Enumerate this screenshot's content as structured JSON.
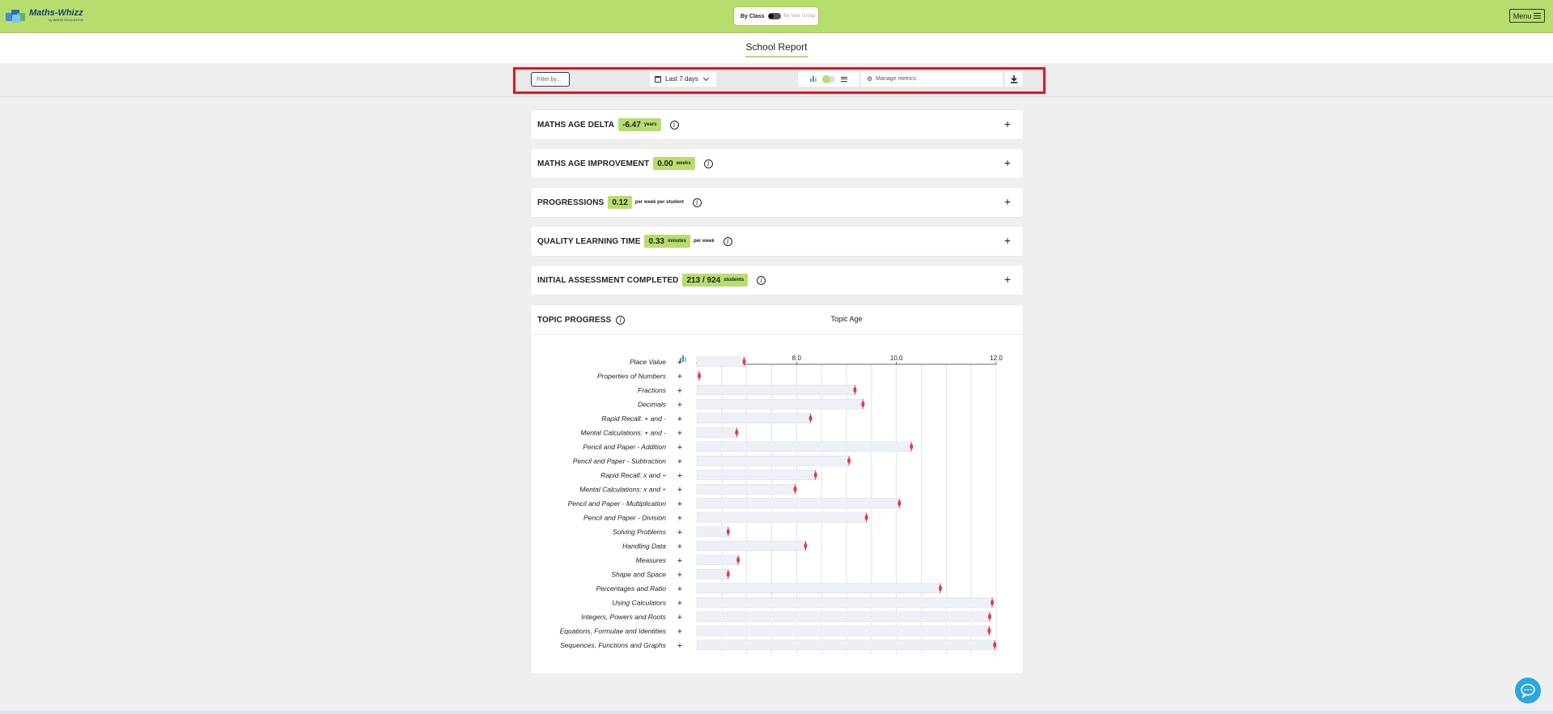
{
  "header": {
    "logo_text": "Maths-Whizz",
    "logo_subtext": "by WHIZZ EDUCATION",
    "toggle_left_label": "By Class",
    "toggle_right_label": "By Year Group",
    "menu_label": "Menu"
  },
  "page": {
    "title": "School Report"
  },
  "toolbar": {
    "filter_label": "Filter by...",
    "date_range_label": "Last 7 days",
    "manage_metrics_label": "Manage metrics"
  },
  "metrics": [
    {
      "title": "MATHS AGE DELTA",
      "value": "-6.47",
      "unit": "years",
      "extra": ""
    },
    {
      "title": "MATHS AGE IMPROVEMENT",
      "value": "0.00",
      "unit": "weeks",
      "extra": ""
    },
    {
      "title": "PROGRESSIONS",
      "value": "0.12",
      "unit": "",
      "extra": "per week per student"
    },
    {
      "title": "QUALITY LEARNING TIME",
      "value": "0.33",
      "unit": "minutes",
      "extra": "per week"
    },
    {
      "title": "INITIAL ASSESSMENT COMPLETED",
      "value": "213 / 924",
      "unit": "students",
      "extra": ""
    }
  ],
  "topic_progress": {
    "title": "TOPIC PROGRESS"
  },
  "colors": {
    "brand_green": "#b7dd6e",
    "highlight_red": "#e5141b",
    "marker_red": "#e53a4a",
    "chat_blue": "#2ca7de"
  },
  "chart_data": {
    "type": "bar",
    "title": "",
    "xlabel": "Topic Age",
    "ylabel": "",
    "xlim": [
      6,
      12
    ],
    "xticks": [
      8.0,
      10.0,
      12.0
    ],
    "xtick_labels": [
      "8.0",
      "10.0",
      "12.0"
    ],
    "categories": [
      "Place Value",
      "Properties of Numbers",
      "Fractions",
      "Decimals",
      "Rapid Recall: + and -",
      "Mental Calculations: + and -",
      "Pencil and Paper - Addition",
      "Pencil and Paper - Subtraction",
      "Rapid Recall: x and ÷",
      "Mental Calculations: x and ÷",
      "Pencil and Paper - Multiplication",
      "Pencil and Paper - Division",
      "Solving Problems",
      "Handling Data",
      "Measures",
      "Shape and Space",
      "Percentages and Ratio",
      "Using Calculators",
      "Integers, Powers and Roots",
      "Equations, Formulae and Identities",
      "Sequences, Functions and Graphs"
    ],
    "values": [
      6.95,
      6.05,
      9.17,
      9.33,
      8.28,
      6.8,
      10.3,
      9.05,
      8.38,
      7.97,
      10.06,
      9.4,
      6.63,
      8.18,
      6.83,
      6.63,
      10.88,
      11.92,
      11.87,
      11.86,
      11.97
    ],
    "grid": true,
    "legend": "none"
  }
}
